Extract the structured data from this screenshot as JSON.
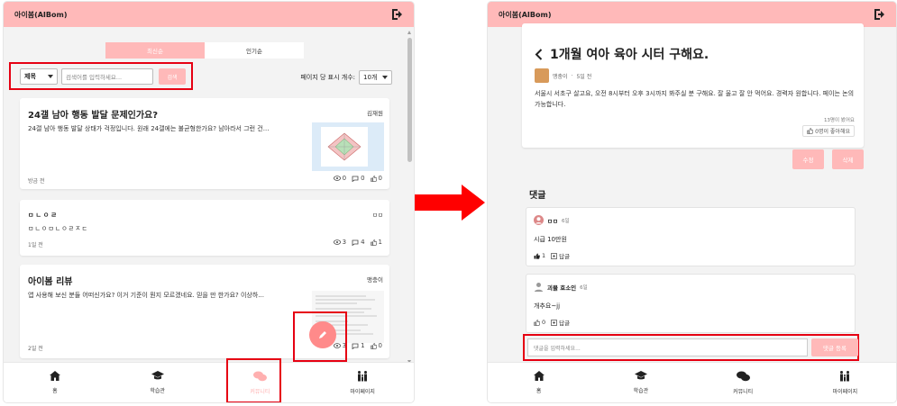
{
  "left": {
    "app_title": "아이봄(AIBom)",
    "tabs": [
      "최신순",
      "인기순"
    ],
    "search": {
      "field_select": "제목",
      "placeholder": "검색어를 입력하세요...",
      "button": "검색"
    },
    "per_page": {
      "label": "페이지 당 표시 개수:",
      "value": "10개"
    },
    "posts": [
      {
        "title": "24갤 남아 행동 발달 문제인가요?",
        "author": "김재원",
        "body": "24갤 남아 행동 발달 상태가 걱정입니다. 원래 24갤에는 불균형한가요? 남아라서 그런 건...",
        "time": "방금 전",
        "views": "0",
        "comments": "0",
        "likes": "0"
      },
      {
        "title": "ㅁㄴㅇㄹ",
        "author": "ㅁㅁ",
        "body": "ㅁㄴㅇㅁㄴㅇㄹㅈㄷ",
        "time": "1일 전",
        "views": "3",
        "comments": "4",
        "likes": "1"
      },
      {
        "title": "아이봄 리뷰",
        "author": "맹충이",
        "body": "앱 사용해 보신 분들 어떠신가요? 이거 기준이 뭔지 모르겠네요. 믿을 만 한가요? 이상하...",
        "time": "2일 전",
        "views": "3",
        "comments": "1",
        "likes": "0"
      }
    ],
    "nav": [
      "홈",
      "학습관",
      "커뮤니티",
      "마이페이지"
    ]
  },
  "right": {
    "app_title": "아이봄(AIBom)",
    "post": {
      "title": "1개월 여아 육아 시터 구해요.",
      "author": "맹충이",
      "time": "5일 전",
      "body": "서울시 서초구 살고요, 오전 8시부터 오후 3시까지 봐주실 분 구해요. 잘 울고 잘 안 먹어요. 경력자 원합니다. 페이는 논의 가능합니다.",
      "views": "13명이 봤어요",
      "likes": "0명이 좋아해요"
    },
    "edit_button": "수정",
    "delete_button": "삭제",
    "comments_title": "댓글",
    "comments": [
      {
        "author": "ㅁㅁ",
        "date": "6일",
        "text": "시급 10만원",
        "likes": "1",
        "reply": "답글"
      },
      {
        "author": "괴물 호소인",
        "date": "6일",
        "text": "개추요~jj",
        "likes": "0",
        "reply": "답글"
      }
    ],
    "comment_placeholder": "댓글을 입력하세요...",
    "comment_submit": "댓글 등록",
    "nav": [
      "홈",
      "학습관",
      "커뮤니티",
      "마이페이지"
    ]
  },
  "colors": {
    "accent": "#ffb9b9",
    "highlight": "#e60012"
  }
}
